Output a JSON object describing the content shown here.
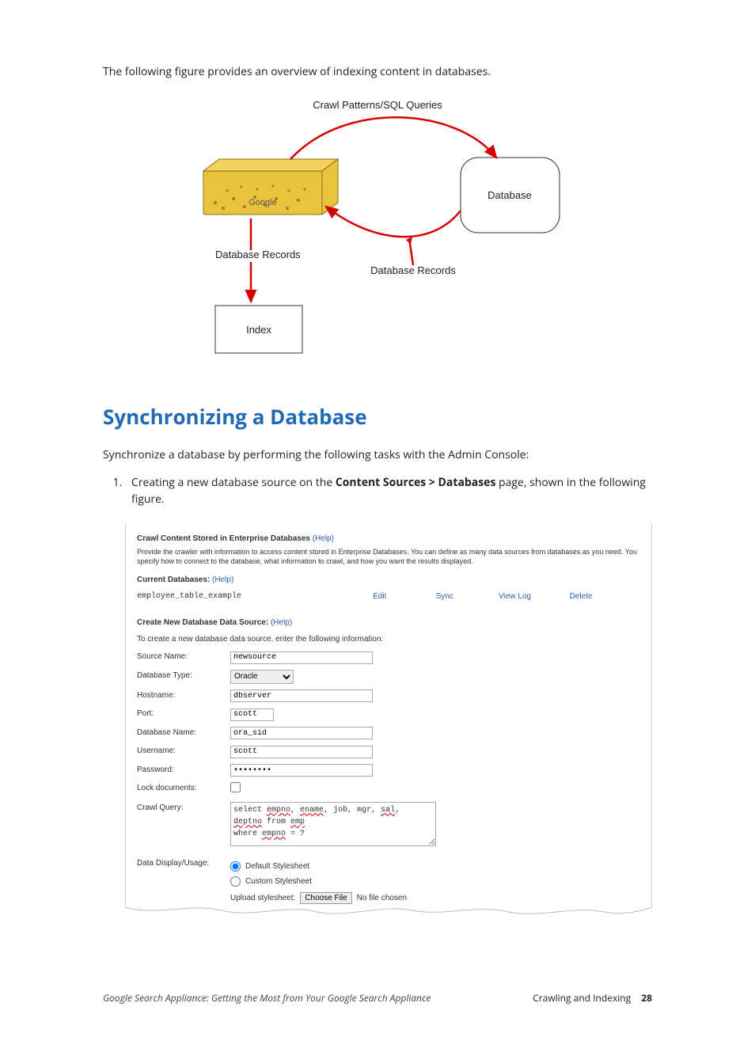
{
  "intro": "The following figure provides an overview of indexing content in databases.",
  "diagram": {
    "top_label": "Crawl Patterns/SQL Queries",
    "db_label": "Database",
    "db_records_left": "Database Records",
    "db_records_mid": "Database Records",
    "index_label": "Index",
    "appliance_logo": "Google"
  },
  "heading": "Synchronizing a Database",
  "sync_intro": "Synchronize a database by performing the following tasks with the Admin Console:",
  "list_item": {
    "num": "1.",
    "before": "Creating a new database source on the ",
    "bold": "Content Sources > Databases",
    "after": " page, shown in the following figure."
  },
  "screenshot": {
    "title": "Crawl Content Stored in Enterprise Databases",
    "help": "(Help)",
    "desc": "Provide the crawler with information to access content stored in Enterprise Databases. You can define as many data sources from databases as you need. You specify how to connect to the database, what information to crawl, and how you want the results displayed.",
    "current_db_label": "Current Databases:",
    "db_example": "employee_table_example",
    "actions": {
      "edit": "Edit",
      "sync": "Sync",
      "viewlog": "View Log",
      "delete": "Delete"
    },
    "create_label": "Create New Database Data Source:",
    "create_sub": "To create a new database data source, enter the following information:",
    "fields": {
      "source_name": {
        "label": "Source Name:",
        "value": "newsource"
      },
      "db_type": {
        "label": "Database Type:",
        "value": "Oracle"
      },
      "hostname": {
        "label": "Hostname:",
        "value": "dbserver"
      },
      "port": {
        "label": "Port:",
        "value": "scott"
      },
      "db_name": {
        "label": "Database Name:",
        "value": "ora_sid"
      },
      "username": {
        "label": "Username:",
        "value": "scott"
      },
      "password": {
        "label": "Password:",
        "value": "••••••••"
      },
      "lock": {
        "label": "Lock documents:"
      },
      "crawl": {
        "label": "Crawl Query:",
        "line1_a": "select ",
        "line1_b": "empno",
        "line1_c": ", ",
        "line1_d": "ename",
        "line1_e": ", job, mgr, ",
        "line1_f": "sal",
        "line1_g": ", ",
        "line1_h": "deptno",
        "line1_i": " from ",
        "line1_j": "emp",
        "line2_a": "where ",
        "line2_b": "empno",
        "line2_c": " = ?"
      },
      "display": {
        "label": "Data Display/Usage:",
        "opt1": "Default Stylesheet",
        "opt2": "Custom Stylesheet",
        "upload_label": "Upload stylesheet:",
        "choose": "Choose File",
        "nofile": "No file chosen"
      }
    }
  },
  "footer": {
    "left": "Google Search Appliance: Getting the Most from Your Google Search Appliance",
    "section": "Crawling and Indexing",
    "page": "28"
  }
}
